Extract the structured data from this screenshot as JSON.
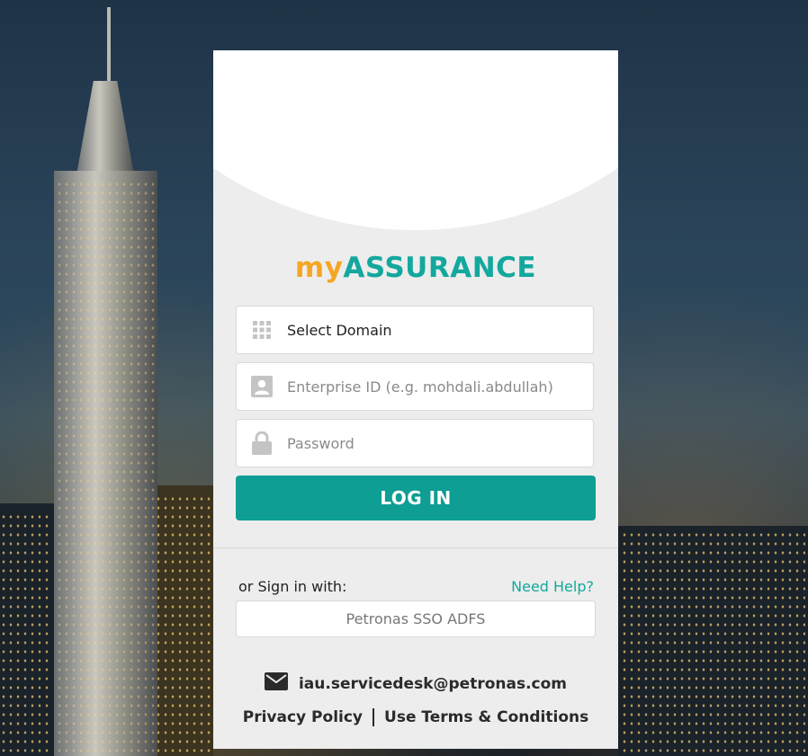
{
  "brand": {
    "prefix": "my",
    "name": "ASSURANCE",
    "prefix_color": "#f5a623",
    "name_color": "#13a89e"
  },
  "form": {
    "domain": {
      "value": "Select Domain",
      "icon": "grid-icon"
    },
    "enterprise_id": {
      "placeholder": "Enterprise ID (e.g. mohdali.abdullah)",
      "icon": "user-id-icon"
    },
    "password": {
      "placeholder": "Password",
      "icon": "lock-icon"
    },
    "login_label": "LOG IN",
    "accent_color": "#0e9e93"
  },
  "alt_signin": {
    "label": "or Sign in with:",
    "help": "Need Help?",
    "sso_label": "Petronas SSO ADFS"
  },
  "footer": {
    "email": "iau.servicedesk@petronas.com",
    "email_icon": "mail-icon",
    "privacy": "Privacy Policy",
    "terms": "Use Terms & Conditions"
  }
}
